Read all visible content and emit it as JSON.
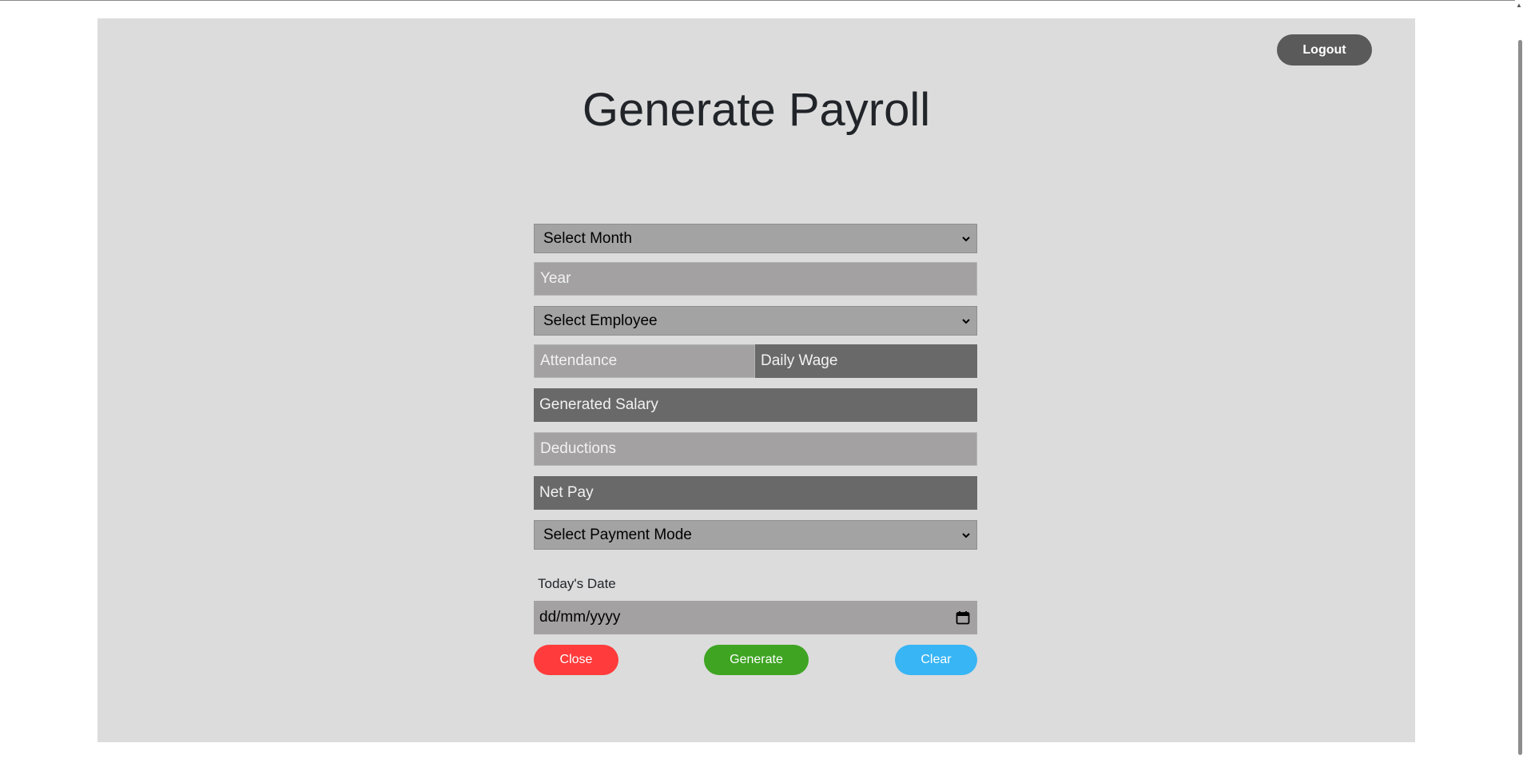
{
  "header": {
    "logout_label": "Logout",
    "title": "Generate Payroll"
  },
  "form": {
    "month_select": {
      "selected": "Select Month"
    },
    "year_input": {
      "placeholder": "Year"
    },
    "employee_select": {
      "selected": "Select Employee"
    },
    "attendance_input": {
      "placeholder": "Attendance"
    },
    "daily_wage_input": {
      "placeholder": "Daily Wage"
    },
    "generated_salary_input": {
      "placeholder": "Generated Salary"
    },
    "deductions_input": {
      "placeholder": "Deductions"
    },
    "net_pay_input": {
      "placeholder": "Net Pay"
    },
    "payment_mode_select": {
      "selected": "Select Payment Mode"
    },
    "date_label": "Today's Date",
    "date_input": {
      "value": "dd/mm/yyyy"
    }
  },
  "buttons": {
    "close_label": "Close",
    "generate_label": "Generate",
    "clear_label": "Clear"
  },
  "colors": {
    "panel": "#dcdcdc",
    "logout": "#5a5a5a",
    "close": "#ff3b3b",
    "generate": "#3ea422",
    "clear": "#37b5f5",
    "field_light": "#a3a1a1",
    "field_dark": "#696969"
  },
  "icons": {
    "select_arrow": "chevron-down-icon",
    "date_picker": "calendar-icon"
  }
}
